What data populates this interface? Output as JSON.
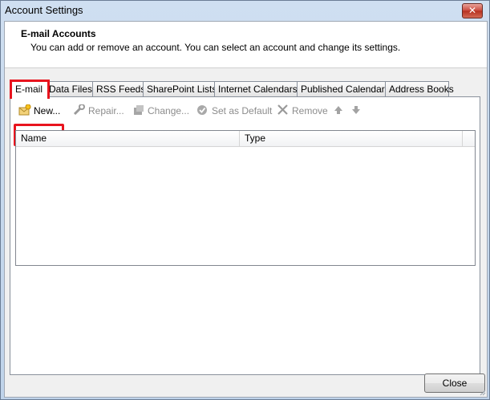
{
  "window": {
    "title": "Account Settings",
    "close_glyph": "✕"
  },
  "header": {
    "title": "E-mail Accounts",
    "description": "You can add or remove an account. You can select an account and change its settings."
  },
  "tabs": [
    {
      "label": "E-mail",
      "active": true
    },
    {
      "label": "Data Files"
    },
    {
      "label": "RSS Feeds"
    },
    {
      "label": "SharePoint Lists"
    },
    {
      "label": "Internet Calendars"
    },
    {
      "label": "Published Calendars"
    },
    {
      "label": "Address Books"
    }
  ],
  "toolbar": {
    "new_label": "New...",
    "repair_label": "Repair...",
    "change_label": "Change...",
    "set_default_label": "Set as Default",
    "remove_label": "Remove"
  },
  "list": {
    "columns": [
      "Name",
      "Type"
    ],
    "rows": []
  },
  "footer": {
    "close_label": "Close"
  },
  "colors": {
    "highlight": "#e8141e",
    "disabled_text": "#8c8c8c"
  },
  "icons": [
    "new-account-icon",
    "repair-icon",
    "change-icon",
    "set-default-icon",
    "remove-icon",
    "move-up-icon",
    "move-down-icon"
  ]
}
